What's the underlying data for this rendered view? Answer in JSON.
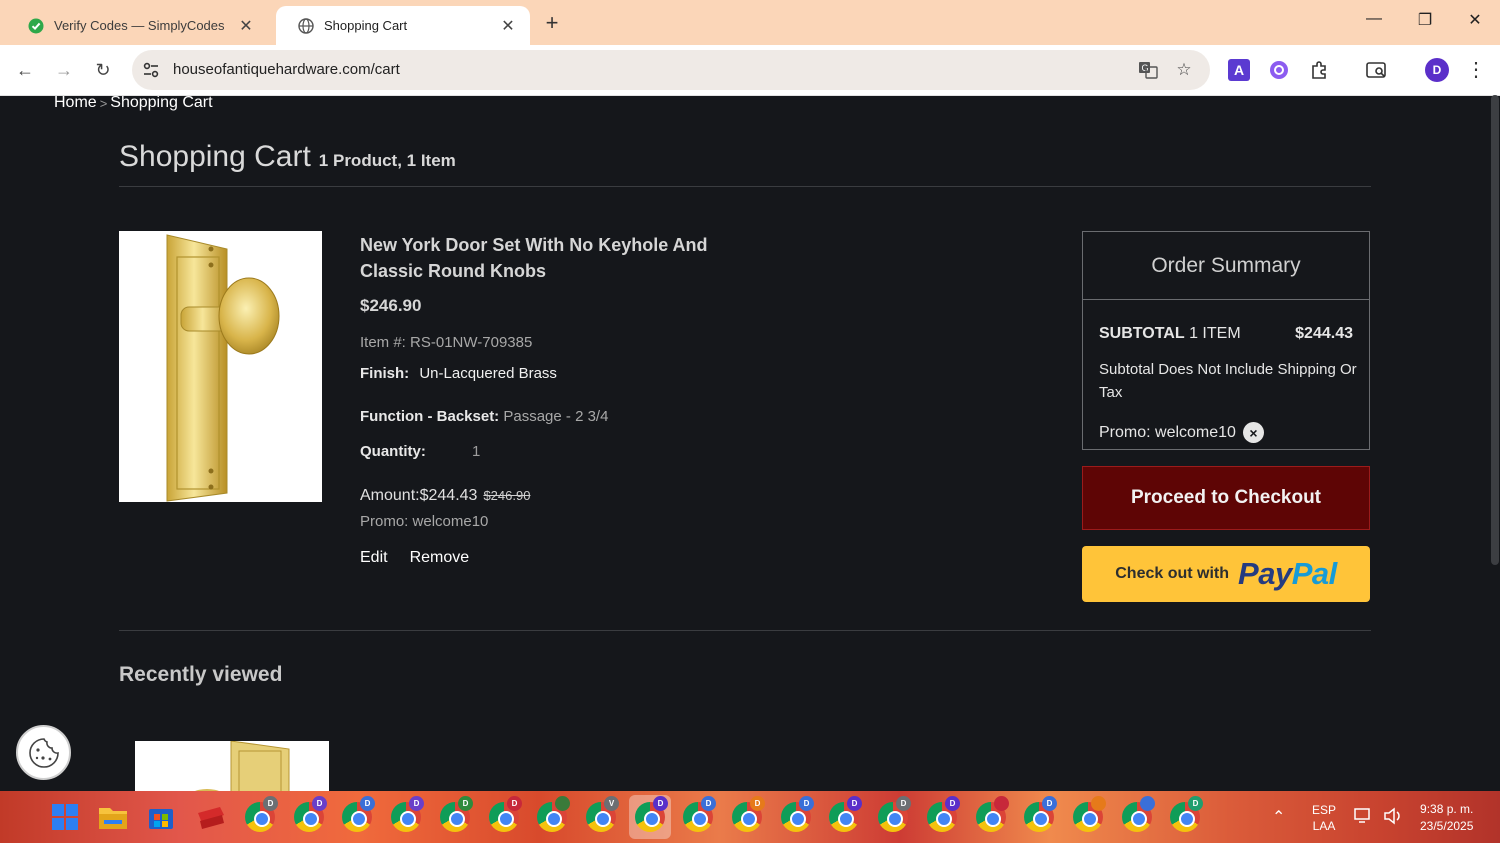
{
  "browser": {
    "tabs": [
      {
        "title": "Verify Codes — SimplyCodes",
        "active": false
      },
      {
        "title": "Shopping Cart",
        "active": true
      }
    ],
    "url": "houseofantiquehardware.com/cart",
    "profile_initial": "D"
  },
  "breadcrumb": {
    "home": "Home",
    "separator": ">",
    "current": "Shopping Cart"
  },
  "cart": {
    "title": "Shopping Cart",
    "subtitle": "1 Product, 1 Item",
    "item": {
      "name": "New York Door Set With No Keyhole And Classic Round Knobs",
      "price": "$246.90",
      "item_number_label": "Item #:",
      "item_number": "RS-01NW-709385",
      "finish_label": "Finish:",
      "finish_value": "Un-Lacquered Brass",
      "function_label": "Function - Backset:",
      "function_value": "Passage - 2 3/4",
      "quantity_label": "Quantity:",
      "quantity_value": "1",
      "amount_label": "Amount:",
      "amount_value": "$244.43",
      "amount_original": "$246.90",
      "promo_text": "Promo: welcome10",
      "edit_label": "Edit",
      "remove_label": "Remove"
    }
  },
  "summary": {
    "title": "Order Summary",
    "subtotal_label": "SUBTOTAL",
    "subtotal_items": "1 ITEM",
    "subtotal_value": "$244.43",
    "note": "Subtotal Does Not Include Shipping Or Tax",
    "promo": "Promo: welcome10",
    "remove_promo_icon": "×"
  },
  "checkout": {
    "button_label": "Proceed to Checkout",
    "paypal_prefix": "Check out with",
    "paypal_brand_1": "Pay",
    "paypal_brand_2": "Pal"
  },
  "recent": {
    "title": "Recently viewed"
  },
  "taskbar": {
    "language_1": "ESP",
    "language_2": "LAA",
    "time": "9:38 p. m.",
    "date": "23/5/2025",
    "chrome_badges": [
      "D",
      "D",
      "D",
      "D",
      "D",
      "D",
      "",
      "V",
      "D",
      "D",
      "D",
      "D",
      "D",
      "D",
      "D",
      "",
      "D",
      "",
      "",
      "D"
    ],
    "badge_colors": [
      "#6c6f73",
      "#6a3fc9",
      "#3a6fd8",
      "#6a3fc9",
      "#2e8b3c",
      "#c7283a",
      "#3a7a3a",
      "#6c6f73",
      "#5a2fc9",
      "#3a6fd8",
      "#e67a1a",
      "#3a6fd8",
      "#5a2fc9",
      "#6c6f73",
      "#5a2fc9",
      "#c7283a",
      "#3a6fd8",
      "#e67a1a",
      "#3a6fd8",
      "#1f9e6e"
    ]
  },
  "colors": {
    "page_bg": "#15171b",
    "checkout_bg": "#5e0505",
    "paypal_bg": "#ffc439",
    "tabbar_bg": "#fbd6b8"
  }
}
